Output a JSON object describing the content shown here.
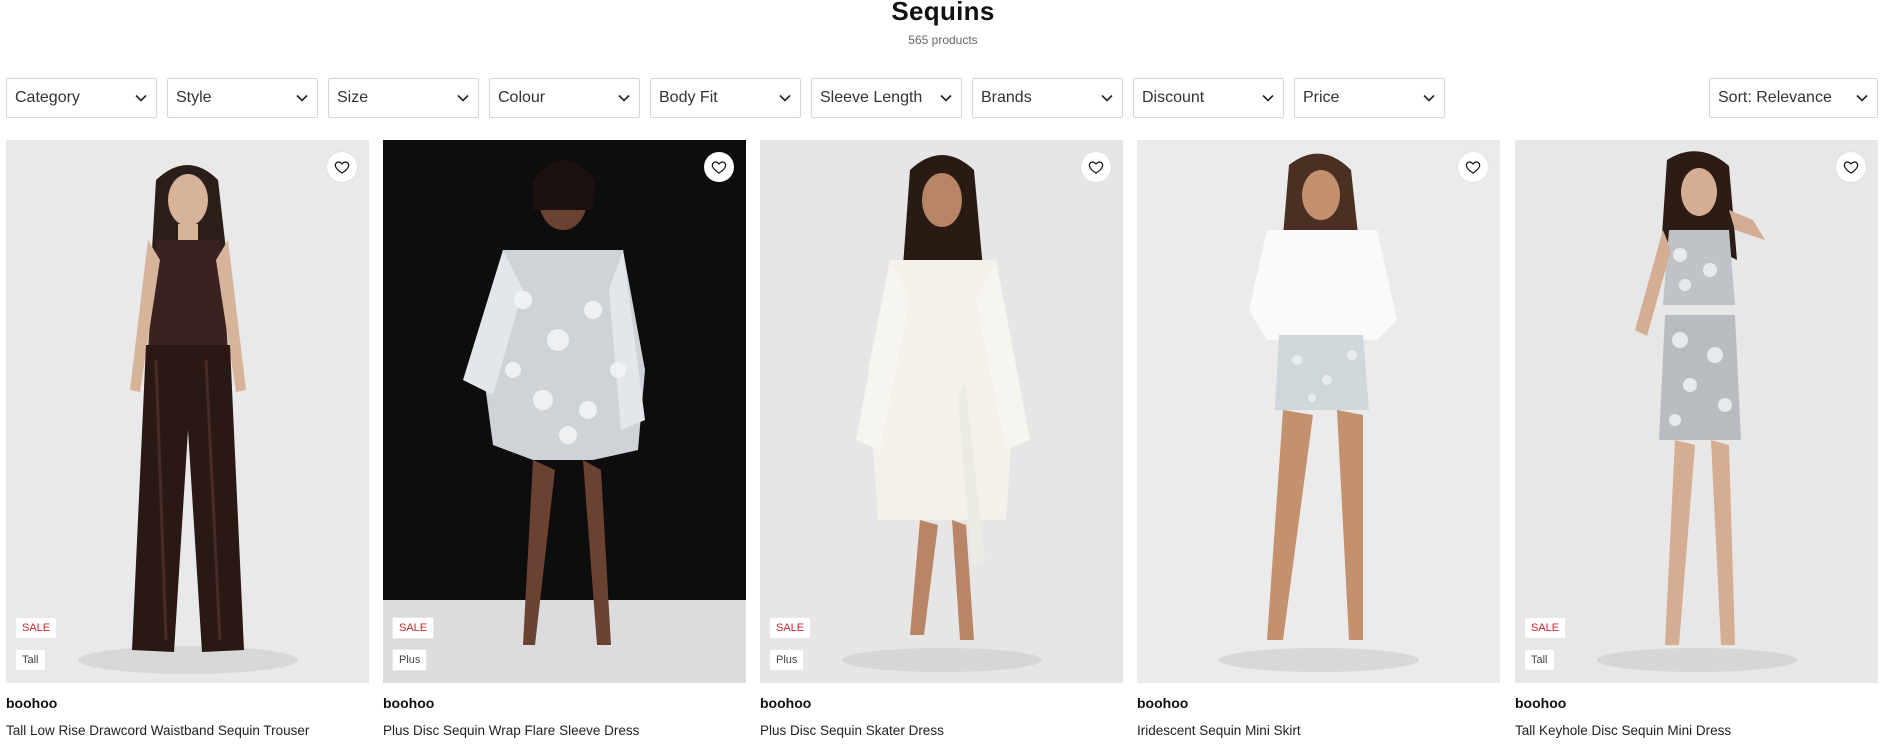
{
  "header": {
    "title": "Sequins",
    "count": "565 products"
  },
  "filters": [
    "Category",
    "Style",
    "Size",
    "Colour",
    "Body Fit",
    "Sleeve Length",
    "Brands",
    "Discount",
    "Price"
  ],
  "sort": {
    "label": "Sort: Relevance"
  },
  "products": [
    {
      "brand": "boohoo",
      "name": "Tall Low Rise Drawcord Waistband Sequin Trouser",
      "badges": [
        "SALE",
        "Tall"
      ]
    },
    {
      "brand": "boohoo",
      "name": "Plus Disc Sequin Wrap Flare Sleeve Dress",
      "badges": [
        "SALE",
        "Plus"
      ]
    },
    {
      "brand": "boohoo",
      "name": "Plus Disc Sequin Skater Dress",
      "badges": [
        "SALE",
        "Plus"
      ]
    },
    {
      "brand": "boohoo",
      "name": "Iridescent Sequin Mini Skirt",
      "badges": []
    },
    {
      "brand": "boohoo",
      "name": "Tall Keyhole Disc Sequin Mini Dress",
      "badges": [
        "SALE",
        "Tall"
      ]
    }
  ],
  "icons": {
    "wishlist": "heart-outline-icon",
    "dropdown": "chevron-down-icon"
  },
  "colors": {
    "sale": "#c62828",
    "border": "#d7d7d7"
  }
}
